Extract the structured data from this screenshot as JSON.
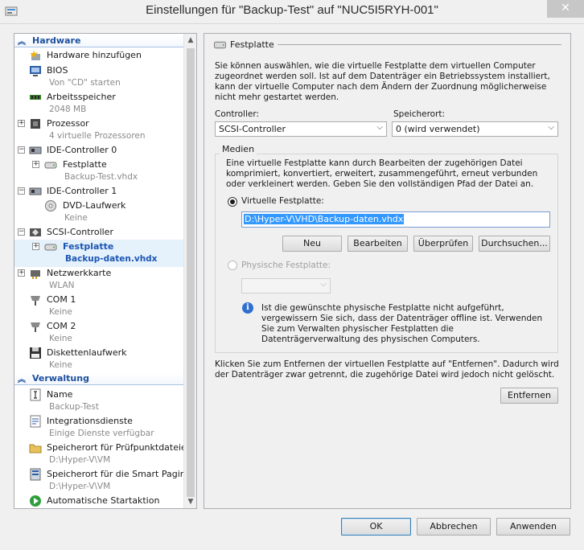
{
  "window": {
    "title": "Einstellungen für \"Backup-Test\" auf \"NUC5I5RYH-001\"",
    "close": "✕"
  },
  "tree": {
    "hardware": "Hardware",
    "management": "Verwaltung",
    "items": [
      {
        "label": "Hardware hinzufügen",
        "sub": ""
      },
      {
        "label": "BIOS",
        "sub": "Von \"CD\" starten"
      },
      {
        "label": "Arbeitsspeicher",
        "sub": "2048 MB"
      },
      {
        "label": "Prozessor",
        "sub": "4 virtuelle Prozessoren"
      },
      {
        "label": "IDE-Controller 0",
        "sub": ""
      },
      {
        "label": "Festplatte",
        "sub": "Backup-Test.vhdx"
      },
      {
        "label": "IDE-Controller 1",
        "sub": ""
      },
      {
        "label": "DVD-Laufwerk",
        "sub": "Keine"
      },
      {
        "label": "SCSI-Controller",
        "sub": ""
      },
      {
        "label": "Festplatte",
        "sub": "Backup-daten.vhdx"
      },
      {
        "label": "Netzwerkkarte",
        "sub": "WLAN"
      },
      {
        "label": "COM 1",
        "sub": "Keine"
      },
      {
        "label": "COM 2",
        "sub": "Keine"
      },
      {
        "label": "Diskettenlaufwerk",
        "sub": "Keine"
      }
    ],
    "mgmt_items": [
      {
        "label": "Name",
        "sub": "Backup-Test"
      },
      {
        "label": "Integrationsdienste",
        "sub": "Einige Dienste verfügbar"
      },
      {
        "label": "Speicherort für Prüfpunktdateien",
        "sub": "D:\\Hyper-V\\VM"
      },
      {
        "label": "Speicherort für die Smart Pagin...",
        "sub": "D:\\Hyper-V\\VM"
      },
      {
        "label": "Automatische Startaktion",
        "sub": ""
      }
    ]
  },
  "pane": {
    "section": "Festplatte",
    "intro": "Sie können auswählen, wie die virtuelle Festplatte dem virtuellen Computer zugeordnet werden soll. Ist auf dem Datenträger ein Betriebssystem installiert, kann der virtuelle Computer nach dem Ändern der Zuordnung möglicherweise nicht mehr gestartet werden.",
    "controller_label": "Controller:",
    "controller_value": "SCSI-Controller",
    "location_label": "Speicherort:",
    "location_value": "0 (wird verwendet)",
    "media_title": "Medien",
    "media_text": "Eine virtuelle Festplatte kann durch Bearbeiten der zugehörigen Datei komprimiert, konvertiert, erweitert, zusammengeführt, erneut verbunden oder verkleinert werden. Geben Sie den vollständigen Pfad der Datei an.",
    "virtual_label": "Virtuelle Festplatte:",
    "path": "D:\\Hyper-V\\VHD\\Backup-daten.vhdx",
    "btn_new": "Neu",
    "btn_edit": "Bearbeiten",
    "btn_check": "Überprüfen",
    "btn_browse": "Durchsuchen...",
    "physical_label": "Physische Festplatte:",
    "info_text": "Ist die gewünschte physische Festplatte nicht aufgeführt, vergewissern Sie sich, dass der Datenträger offline ist. Verwenden Sie zum Verwalten physischer Festplatten die Datenträgerverwaltung des physischen Computers.",
    "remove_text": "Klicken Sie zum Entfernen der virtuellen Festplatte auf \"Entfernen\". Dadurch wird der Datenträger zwar getrennt, die zugehörige Datei wird jedoch nicht gelöscht.",
    "btn_remove": "Entfernen"
  },
  "footer": {
    "ok": "OK",
    "cancel": "Abbrechen",
    "apply": "Anwenden"
  }
}
